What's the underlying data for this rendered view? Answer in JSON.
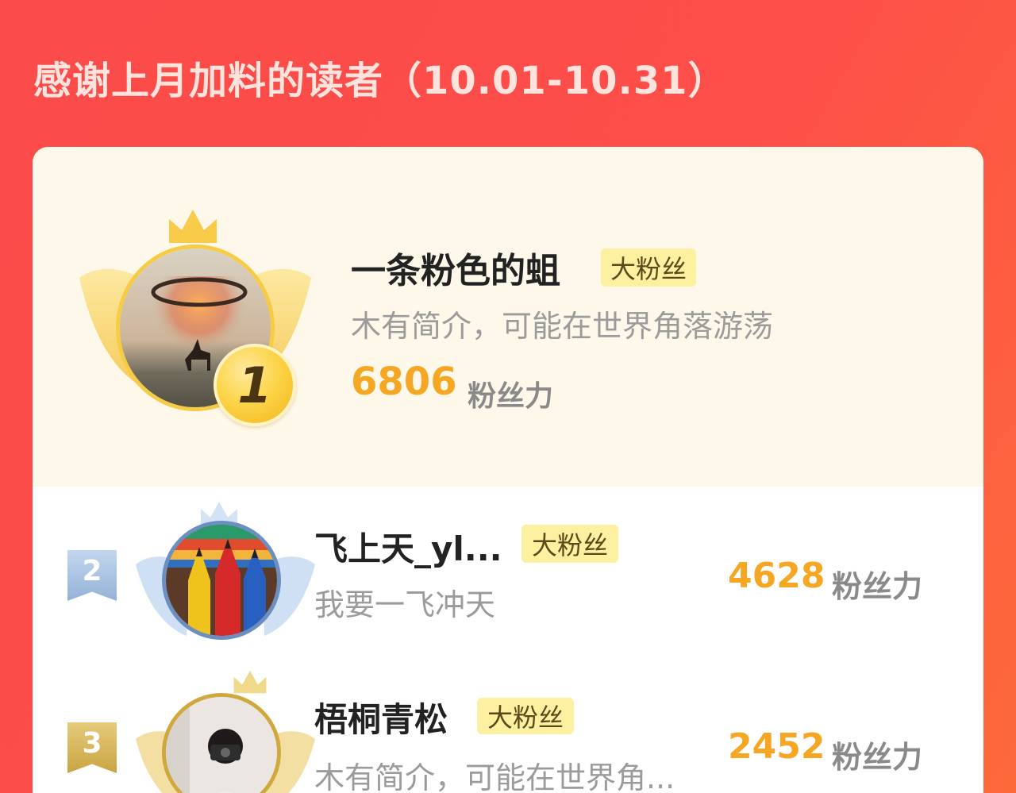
{
  "header": {
    "title": "感谢上月加料的读者（10.01-10.31）"
  },
  "ranking": [
    {
      "rank": "1",
      "name": "一条粉色的蛆",
      "badge": "大粉丝",
      "bio": "木有简介，可能在世界角落游荡",
      "score": "6806",
      "score_unit": "粉丝力"
    },
    {
      "rank": "2",
      "name": "飞上天_yl...",
      "badge": "大粉丝",
      "bio": "我要一飞冲天",
      "score": "4628",
      "score_unit": "粉丝力"
    },
    {
      "rank": "3",
      "name": "梧桐青松",
      "badge": "大粉丝",
      "bio": "木有简介，可能在世界角...",
      "score": "2452",
      "score_unit": "粉丝力"
    }
  ],
  "colors": {
    "background": "#fd4e49",
    "score": "#f5a623",
    "badge_bg": "#fdf0a0",
    "rank1": "#fcd54a",
    "rank2": "#a9c4e4",
    "rank3": "#d9b95a"
  },
  "icons": {
    "crown": "crown-icon",
    "wings": "wings-icon",
    "medal": "rank-medal-icon",
    "flag": "rank-flag-icon"
  }
}
